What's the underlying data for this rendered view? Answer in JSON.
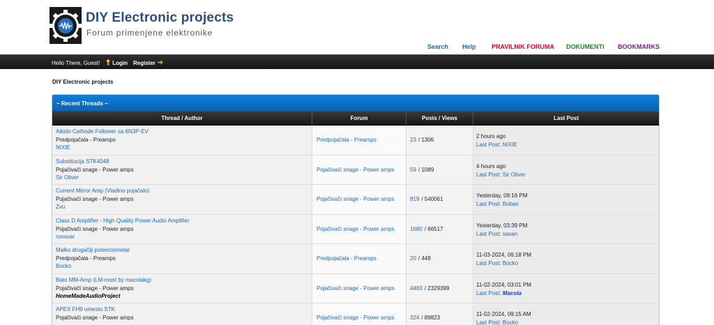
{
  "header": {
    "title": "DIY Electronic projects",
    "subtitle": "Forum primenjene elektronike",
    "top_links": [
      {
        "label": "Search",
        "color": "#1e69b3"
      },
      {
        "label": "Help",
        "color": "#1e69b3"
      },
      {
        "label": "PRAVILNIK FORUMA",
        "color": "#e0001b"
      },
      {
        "label": "DOKUMENTI",
        "color": "#1a8a1a"
      },
      {
        "label": "BOOKMARKS",
        "color": "#7a1f8c"
      }
    ]
  },
  "nav": {
    "greeting": "Hello There, Guest!",
    "login": "Login",
    "register": "Register"
  },
  "breadcrumb": "DIY Electronic projects",
  "threads": {
    "heading": "~ Recent Threads ~",
    "columns": [
      "Thread / Author",
      "Forum",
      "Posts / Views",
      "Last Post"
    ],
    "rows": [
      {
        "title": "Aikido Cathode Follower sa 6N3P-EV",
        "forum": "Predpojačala - Preamps",
        "author": "NIXIE",
        "author_special": false,
        "forum_link": "Predpojačala - Preamps",
        "posts": "23",
        "views": "/ 1306",
        "last_time": "2 hours ago",
        "last_prefix": "Last Post: ",
        "last_user": "NIXIE",
        "last_special": false
      },
      {
        "title": "Substitucija STK4048",
        "forum": "Pojačivači snage - Power amps",
        "author": "Sir Oliver",
        "author_special": false,
        "forum_link": "Pojačivači snage - Power amps",
        "posts": "59",
        "views": "/ 1089",
        "last_time": "4 hours ago",
        "last_prefix": "Last Post: ",
        "last_user": "Sir Oliver",
        "last_special": false
      },
      {
        "title": "Current Mirror Amp (Vladino pojačalo)",
        "forum": "Pojačivači snage - Power amps",
        "author": "Zvu",
        "author_special": false,
        "forum_link": "Pojačivači snage - Power amps",
        "posts": "819",
        "views": "/ 540061",
        "last_time": "Yesterday, 09:16 PM",
        "last_prefix": "Last Post: ",
        "last_user": "Boban",
        "last_special": false
      },
      {
        "title": "Class D Amplifier - High Quality Power Audio Amplifier",
        "forum": "Pojačivači snage - Power amps",
        "author": "ronovar",
        "author_special": false,
        "forum_link": "Pojačivači snage - Power amps",
        "posts": "1680",
        "views": "/ 66517",
        "last_time": "Yesterday, 03:39 PM",
        "last_prefix": "Last Post: ",
        "last_user": "savan",
        "last_special": false
      },
      {
        "title": "Malko drugačiji potenciometar",
        "forum": "Predpojačala - Preamps",
        "author": "Bocko",
        "author_special": false,
        "forum_link": "Predpojačala - Preamps",
        "posts": "20",
        "views": "/ 448",
        "last_time": "11-03-2024, 06:18 PM",
        "last_prefix": "Last Post: ",
        "last_user": "Bocko",
        "last_special": false
      },
      {
        "title": "Bato MM-Amp (LM-most by macolakg)",
        "forum": "Pojačivači snage - Power amps",
        "author": "HomeMadeAudioProject",
        "author_special": true,
        "forum_link": "Pojačivači snage - Power amps",
        "posts": "4483",
        "views": "/ 2329399",
        "last_time": "11-02-2024, 03:01 PM",
        "last_prefix": "Last Post: ",
        "last_user": "Macola",
        "last_special": true
      },
      {
        "title": "APEX FH9 umesto STK",
        "forum": "Pojačivači snage - Power amps",
        "author": "",
        "author_special": false,
        "forum_link": "Pojačivači snage - Power amps",
        "posts": "324",
        "views": "/ 89823",
        "last_time": "11-02-2024, 09:15 AM",
        "last_prefix": "Last Post: ",
        "last_user": "Bocko",
        "last_special": false
      }
    ]
  }
}
